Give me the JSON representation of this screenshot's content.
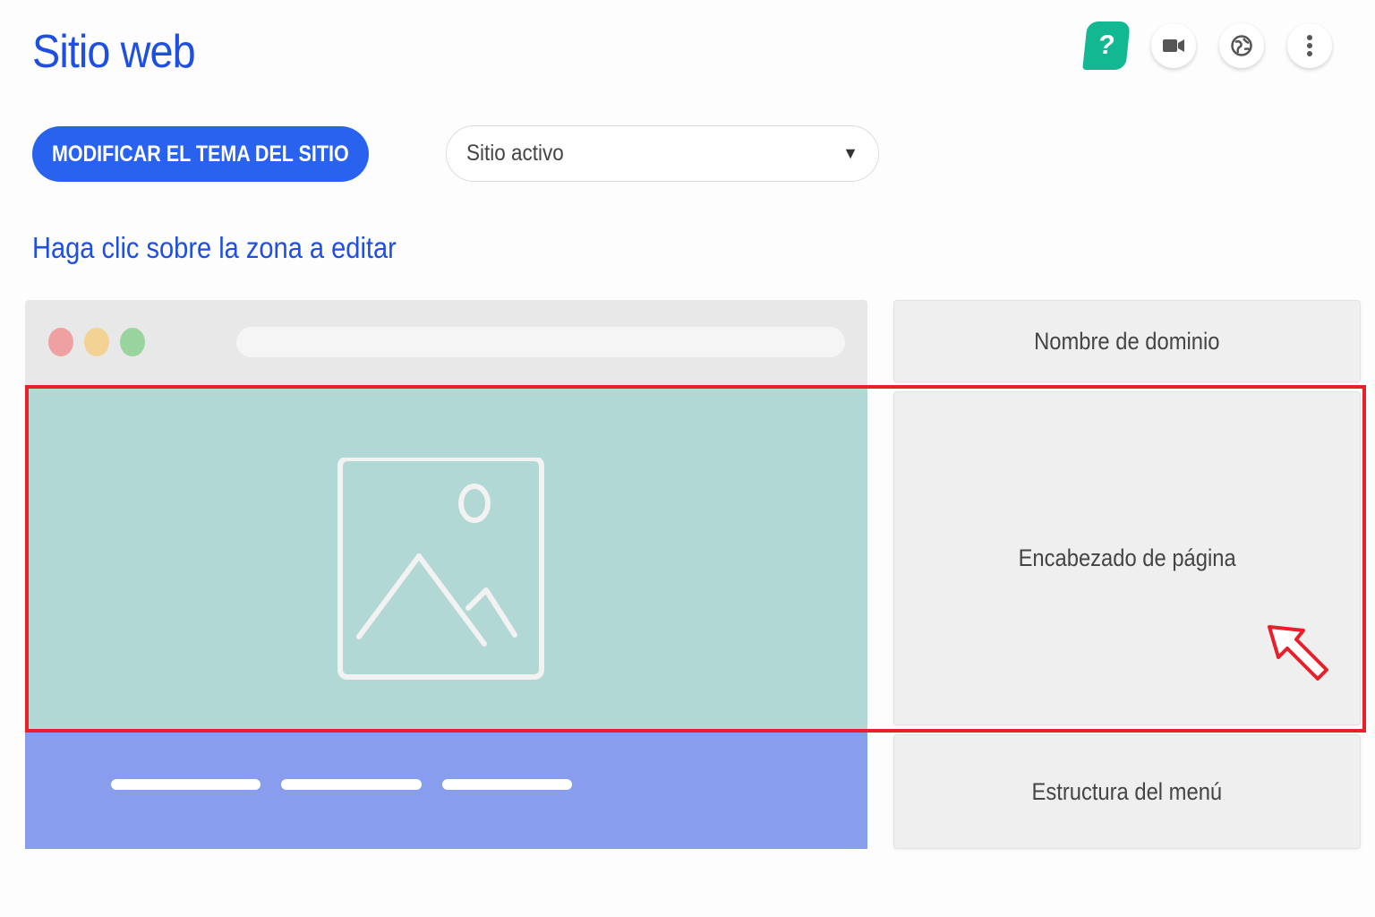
{
  "header": {
    "title": "Sitio web",
    "help_label": "?"
  },
  "toolbar": {
    "theme_button_label": "MODIFICAR EL TEMA DEL SITIO",
    "site_select_value": "Sitio activo"
  },
  "instruction": "Haga clic sobre la zona a editar",
  "zones": {
    "domain": "Nombre de dominio",
    "header": "Encabezado de página",
    "menu": "Estructura del menú"
  },
  "colors": {
    "accent": "#1f4fe0",
    "help": "#12b892",
    "hero": "#b2d8d6",
    "menu_band": "#889ded",
    "highlight": "#e8202a"
  }
}
